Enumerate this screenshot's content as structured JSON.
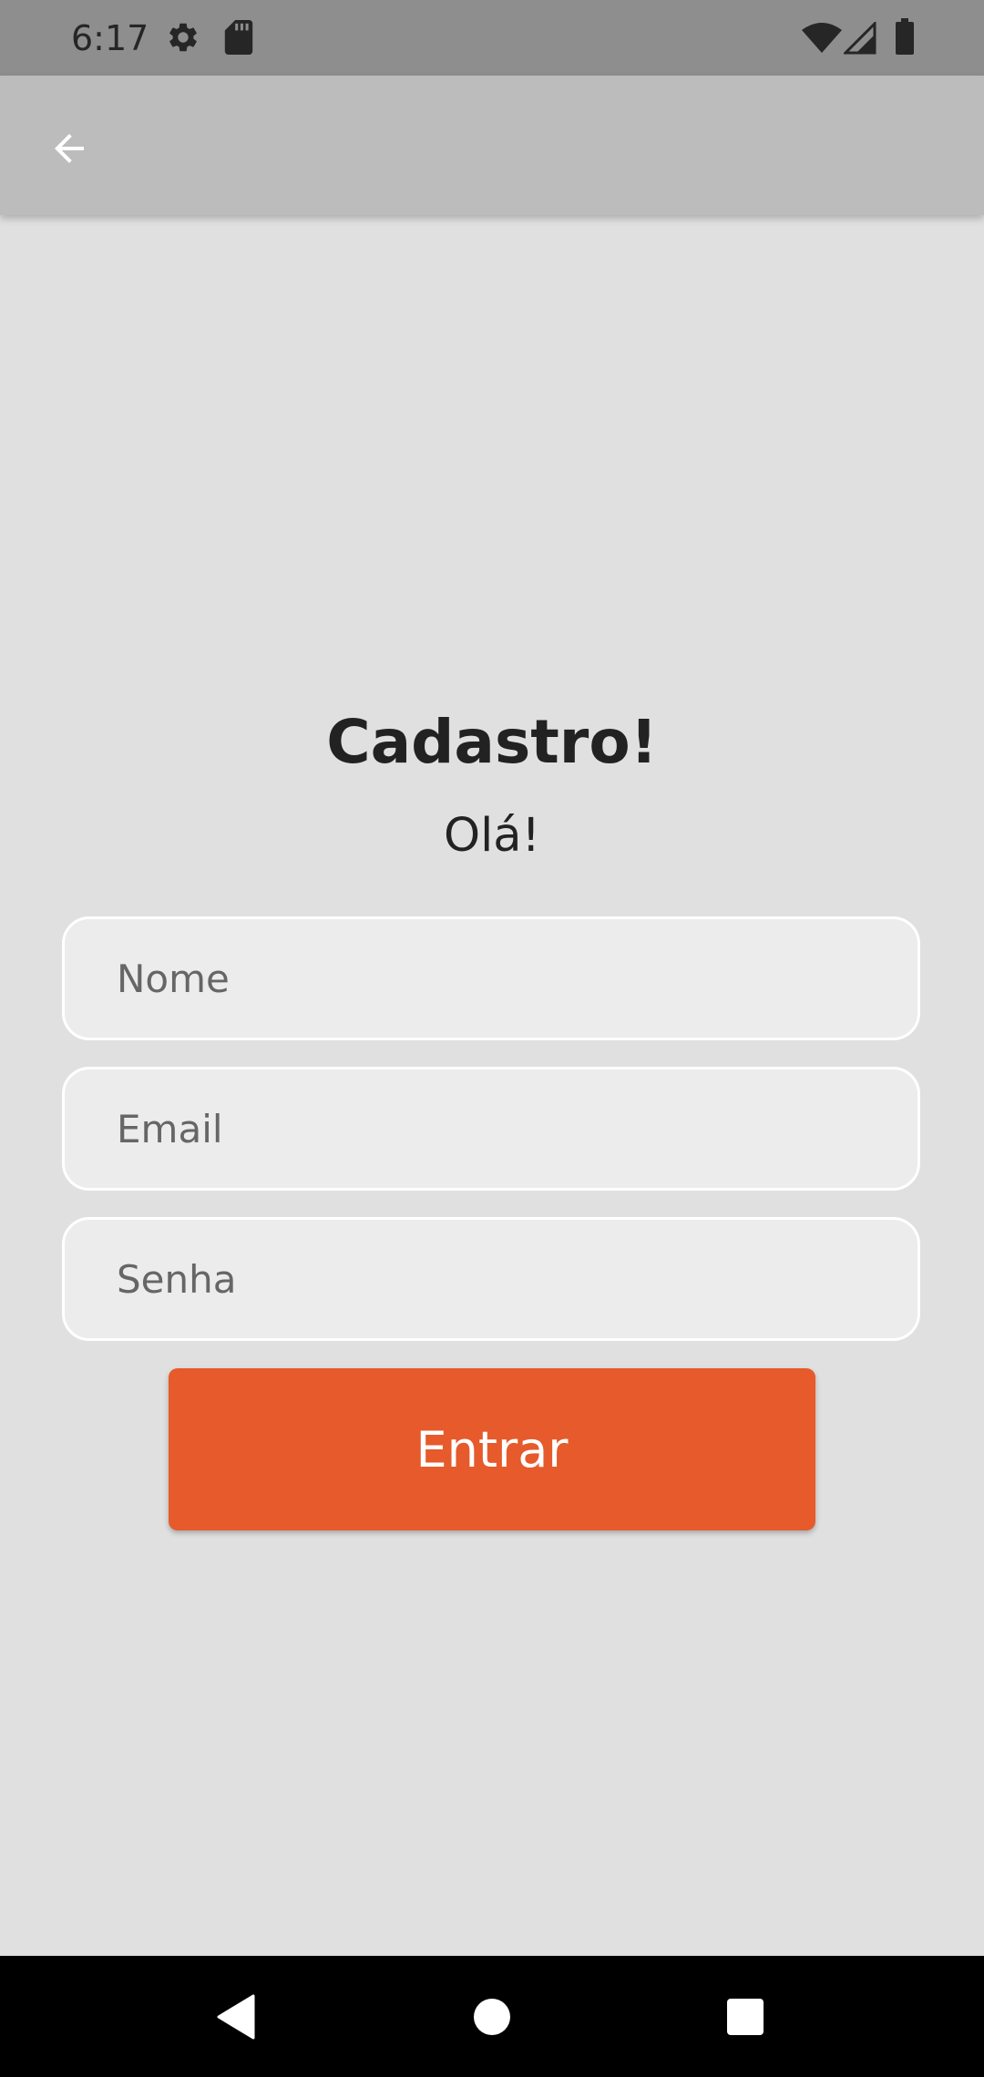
{
  "status_bar": {
    "time": "6:17",
    "left_icons": [
      "settings-icon",
      "sd-card-icon"
    ],
    "right_icons": [
      "wifi-icon",
      "signal-icon",
      "battery-icon"
    ]
  },
  "app_bar": {
    "back_icon": "arrow-back-icon"
  },
  "form": {
    "title": "Cadastro!",
    "subtitle": "Olá!",
    "name_placeholder": "Nome",
    "email_placeholder": "Email",
    "password_placeholder": "Senha",
    "submit_label": "Entrar"
  },
  "nav_bar": {
    "icons": [
      "back-triangle-icon",
      "home-circle-icon",
      "recents-square-icon"
    ]
  },
  "colors": {
    "status_bar": "#8e8e8e",
    "app_bar": "#bcbcbc",
    "background": "#e0e0e0",
    "field_background": "#ececec",
    "accent": "#e65a2b",
    "nav_bar": "#000000"
  }
}
